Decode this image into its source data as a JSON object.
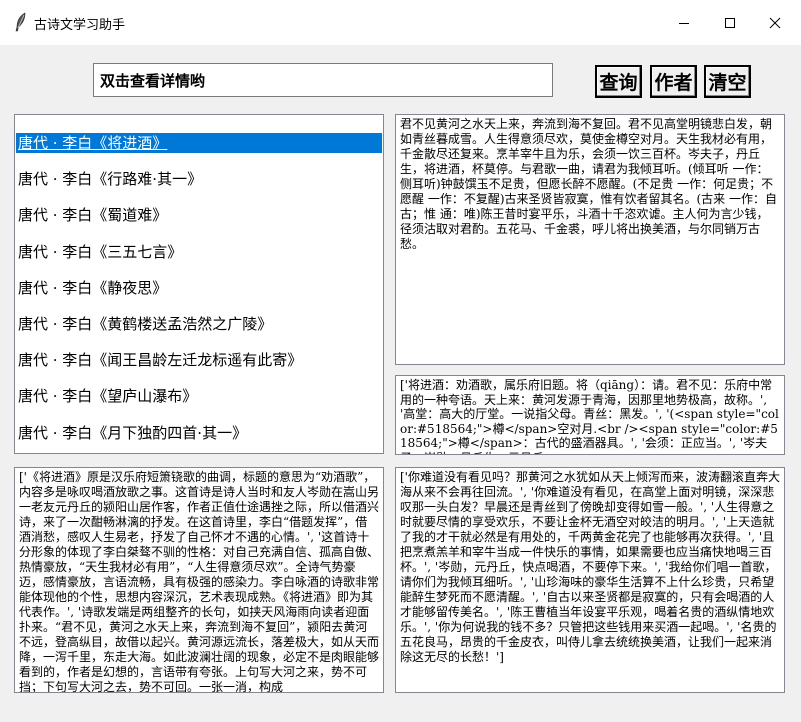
{
  "window": {
    "title": "古诗文学习助手",
    "icon": "feather-icon"
  },
  "search": {
    "value": "双击查看详情哟"
  },
  "buttons": {
    "query": "查询",
    "author": "作者",
    "clear": "清空"
  },
  "list": {
    "selected_index": 0,
    "items": [
      "唐代 · 李白《将进酒》",
      "唐代 · 李白《行路难·其一》",
      "唐代 · 李白《蜀道难》",
      "唐代 · 李白《三五七言》",
      "唐代 · 李白《静夜思》",
      "唐代 · 李白《黄鹤楼送孟浩然之广陵》",
      "唐代 · 李白《闻王昌龄左迁龙标遥有此寄》",
      "唐代 · 李白《望庐山瀑布》",
      "唐代 · 李白《月下独酌四首·其一》"
    ]
  },
  "poem_text": "君不见黄河之水天上来，奔流到海不复回。君不见高堂明镜悲白发，朝如青丝暮成雪。人生得意须尽欢，莫使金樽空对月。天生我材必有用，千金散尽还复来。烹羊宰牛且为乐，会须一饮三百杯。岑夫子，丹丘生，将进酒，杯莫停。与君歌一曲，请君为我倾耳听。(倾耳听 一作：侧耳听)钟鼓馔玉不足贵，但愿长醉不愿醒。(不足贵 一作：何足贵；不愿醒 一作：不复醒)古来圣贤皆寂寞，惟有饮者留其名。(古来 一作：自古；惟 通：唯)陈王昔时宴平乐，斗酒十千恣欢谑。主人何为言少钱，径须沽取对君酌。五花马、千金裘，呼儿将出换美酒，与尔同销万古愁。",
  "notes_text": "['将进酒：劝酒歌，属乐府旧题。将（qiāng）：请。君不见：乐府中常用的一种夸语。天上来：黄河发源于青海，因那里地势极高，故称。', '高堂：高大的厅堂。一说指父母。青丝：黑发。', '(<span style=\"color:#518564;\">樽</span>空对月.<br /><span style=\"color:#518564;\">樽</span>：古代的盛酒器具。', '会须：正应当。', '岑夫子：岑勋。丹丘生：元丹丘。",
  "analysis_text": "['《将进酒》原是汉乐府短箫铙歌的曲调，标题的意思为“劝酒歌”，内容多是咏叹喝酒放歌之事。这首诗是诗人当时和友人岑勋在嵩山另一老友元丹丘的颍阳山居作客，作者正值仕途遇挫之际，所以借酒兴诗，来了一次酣畅淋漓的抒发。在这首诗里，李白“借题发挥”，借酒消愁，感叹人生易老，抒发了自己怀才不遇的心情。', '这首诗十分形象的体现了李白桀骜不驯的性格：对自己充满自信、孤高自傲、热情豪放，“天生我材必有用”，“人生得意须尽欢”。全诗气势豪迈，感情豪放，言语流畅，具有极强的感染力。李白咏酒的诗歌非常能体现他的个性，思想内容深沉，艺术表现成熟。《将进酒》即为其代表作。', '诗歌发端是两组整齐的长句，如挟天风海雨向读者迎面扑来。“君不见，黄河之水天上来，奔流到海不复回”，颍阳去黄河不远，登高纵目，故借以起兴。黄河源远流长，落差极大，如从天而降，一泻千里，东走大海。如此波澜壮阔的现象，必定不是肉眼能够看到的，作者是幻想的，言语带有夸张。上句写大河之来，势不可挡；下句写大河之去，势不可回。一张一消，构成",
  "translation_text": "['你难道没有看见吗？那黄河之水犹如从天上倾泻而来，波涛翻滚直奔大海从来不会再往回流。', '你难道没有看见，在高堂上面对明镜，深深悲叹那一头白发？早晨还是青丝到了傍晚却变得如雪一般。', '人生得意之时就要尽情的享受欢乐，不要让金杯无酒空对皎洁的明月。', '上天造就了我的才干就必然是有用处的，千两黄金花完了也能够再次获得。', '且把烹煮羔羊和宰牛当成一件快乐的事情，如果需要也应当痛快地喝三百杯。', '岑勋，元丹丘，快点喝酒，不要停下来。', '我给你们唱一首歌，请你们为我倾耳细听。', '山珍海味的豪华生活算不上什么珍贵，只希望能醉生梦死而不愿清醒。', '自古以来圣贤都是寂寞的，只有会喝酒的人才能够留传美名。', '陈王曹植当年设宴平乐观，喝着名贵的酒纵情地欢乐。', '你为何说我的钱不多？只管把这些钱用来买酒一起喝。', '名贵的五花良马，昂贵的千金皮衣，叫侍儿拿去统统换美酒，让我们一起来消除这无尽的长愁！']"
}
